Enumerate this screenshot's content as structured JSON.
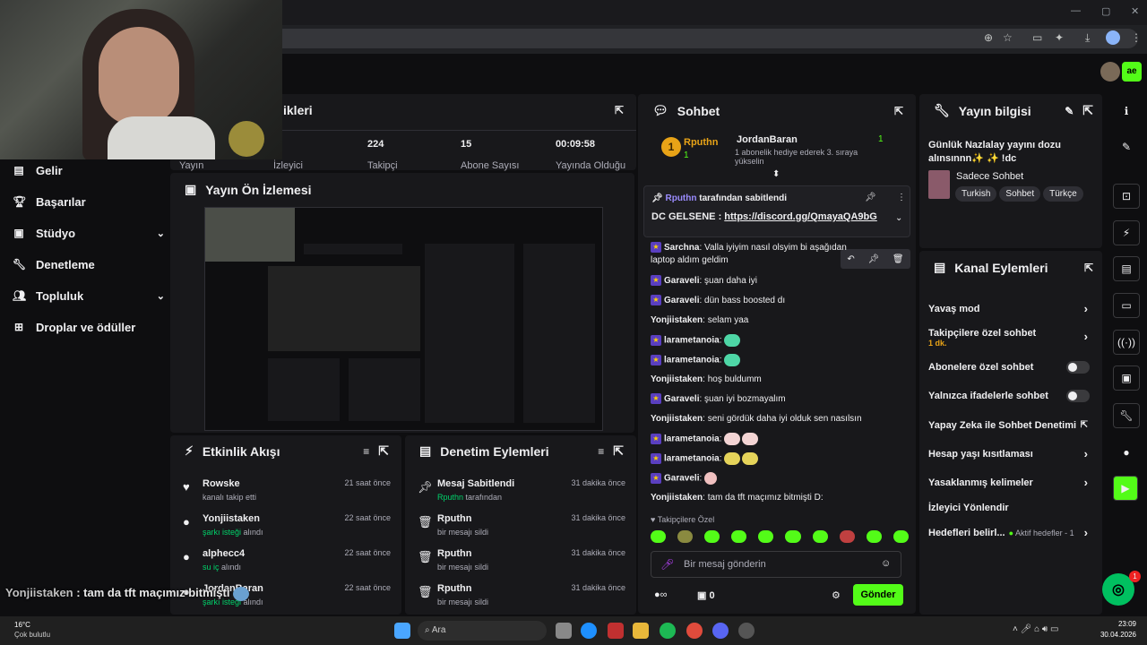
{
  "browser": {
    "weather_temp": "16°C",
    "weather_desc": "Çok bulutlu",
    "search_label": "Ara",
    "clock_time": "23:09",
    "clock_date": "30.04.2026"
  },
  "nav": {
    "items": [
      {
        "label": "Gelir",
        "icon": "dollar-icon"
      },
      {
        "label": "Başarılar",
        "icon": "trophy-icon"
      },
      {
        "label": "Stüdyo",
        "icon": "studio-icon"
      },
      {
        "label": "Denetleme",
        "icon": "wrench-icon"
      },
      {
        "label": "Topluluk",
        "icon": "people-icon"
      },
      {
        "label": "Droplar ve ödüller",
        "icon": "gift-icon"
      }
    ]
  },
  "stats": {
    "title_partial": "ikleri",
    "values": [
      "224",
      "15",
      "00:09:58"
    ],
    "labels": [
      "Yayın",
      "İzleyici",
      "Takipçi",
      "Abone Sayısı",
      "Yayında Olduğu"
    ]
  },
  "preview": {
    "title": "Yayın Ön İzlemesi"
  },
  "activity": {
    "title": "Etkinlik Akışı",
    "items": [
      {
        "name": "Rowske",
        "sub": "kanalı takip etti",
        "hl": "",
        "time": "21 saat önce"
      },
      {
        "name": "Yonjiistaken",
        "sub": " alındı",
        "hl": "şarkı isteği",
        "time": "22 saat önce"
      },
      {
        "name": "alphecc4",
        "sub": " alındı",
        "hl": "su iç",
        "time": "22 saat önce"
      },
      {
        "name": "JordanBaran",
        "sub": " alındı",
        "hl": "şarkı isteği",
        "time": "22 saat önce"
      }
    ]
  },
  "modact": {
    "title": "Denetim Eylemleri",
    "items": [
      {
        "name": "Mesaj Sabitlendi",
        "sub": " tarafından",
        "hl": "Rputhn",
        "time": "31 dakika önce"
      },
      {
        "name": "Rputhn",
        "sub": "bir mesajı sildi",
        "hl": "",
        "time": "31 dakika önce"
      },
      {
        "name": "Rputhn",
        "sub": "bir mesajı sildi",
        "hl": "",
        "time": "31 dakika önce"
      },
      {
        "name": "Rputhn",
        "sub": "bir mesajı sildi",
        "hl": "",
        "time": "31 dakika önce"
      }
    ]
  },
  "chat": {
    "title": "Sohbet",
    "leader1_name": "Rputhn",
    "leader1_rank": "1",
    "leader1_count": "1",
    "leader2_name": "JordanBaran",
    "leader2_count": "1",
    "leader2_desc": "1 abonelik hediye ederek 3. sıraya yükselin",
    "pinned_by": "Rputhn",
    "pinned_suffix": " tarafından sabitlendi",
    "pinned_text": "DC GELSENE : ",
    "pinned_link": "https://discord.gg/QmayaQA9bG",
    "messages": [
      {
        "user": "Sarchna",
        "text": "Valla iyiyim nasıl olsyim bi aşağıdan laptop aldım geldim"
      },
      {
        "user": "Garaveli",
        "text": "şuan daha iyi"
      },
      {
        "user": "Garaveli",
        "text": "dün bass boosted dı"
      },
      {
        "user": "Yonjiistaken",
        "text": "selam yaa"
      },
      {
        "user": "larametanoia",
        "text": ""
      },
      {
        "user": "larametanoia",
        "text": ""
      },
      {
        "user": "Yonjiistaken",
        "text": "hoş buldumm"
      },
      {
        "user": "Garaveli",
        "text": "şuan iyi bozmayalım"
      },
      {
        "user": "Yonjiistaken",
        "text": "seni gördük daha iyi olduk sen nasılsın"
      },
      {
        "user": "larametanoia",
        "text": ""
      },
      {
        "user": "larametanoia",
        "text": ""
      },
      {
        "user": "Garaveli",
        "text": ""
      },
      {
        "user": "Yonjiistaken",
        "text": "tam da tft maçımız bitmişti D:"
      }
    ],
    "followers_only": "Takipçilere Özel",
    "input_placeholder": "Bir mesaj gönderin",
    "points": "0",
    "send_label": "Gönder"
  },
  "streaminfo": {
    "title": "Yayın bilgisi",
    "stream_title": "Günlük Nazlalay yayını dozu alınsınnn✨ ✨ !dc",
    "category": "Sadece Sohbet",
    "tags": [
      "Turkish",
      "Sohbet",
      "Türkçe"
    ]
  },
  "channelact": {
    "title": "Kanal Eylemleri",
    "rows": [
      {
        "label": "Yavaş mod",
        "sub": ""
      },
      {
        "label": "Takipçilere özel sohbet",
        "sub": "1 dk."
      },
      {
        "label": "Abonelere özel sohbet",
        "sub": ""
      },
      {
        "label": "Yalnızca ifadelerle sohbet",
        "sub": ""
      },
      {
        "label": "Yapay Zeka ile Sohbet Denetimi",
        "sub": ""
      },
      {
        "label": "Hesap yaşı kısıtlaması",
        "sub": ""
      },
      {
        "label": "Yasaklanmış kelimeler",
        "sub": ""
      },
      {
        "label": "İzleyici Yönlendir",
        "sub": ""
      },
      {
        "label": "Hedefleri belirl...",
        "sub": "Aktif hedefler - 1"
      }
    ]
  },
  "overlay": {
    "user": "Yonjiistaken",
    "text": " : tam da tft maçımız bitmişti"
  },
  "notif_count": "1",
  "colors": {
    "accent": "#53fc18",
    "bg": "#0e0e10",
    "panel": "#18181b"
  }
}
